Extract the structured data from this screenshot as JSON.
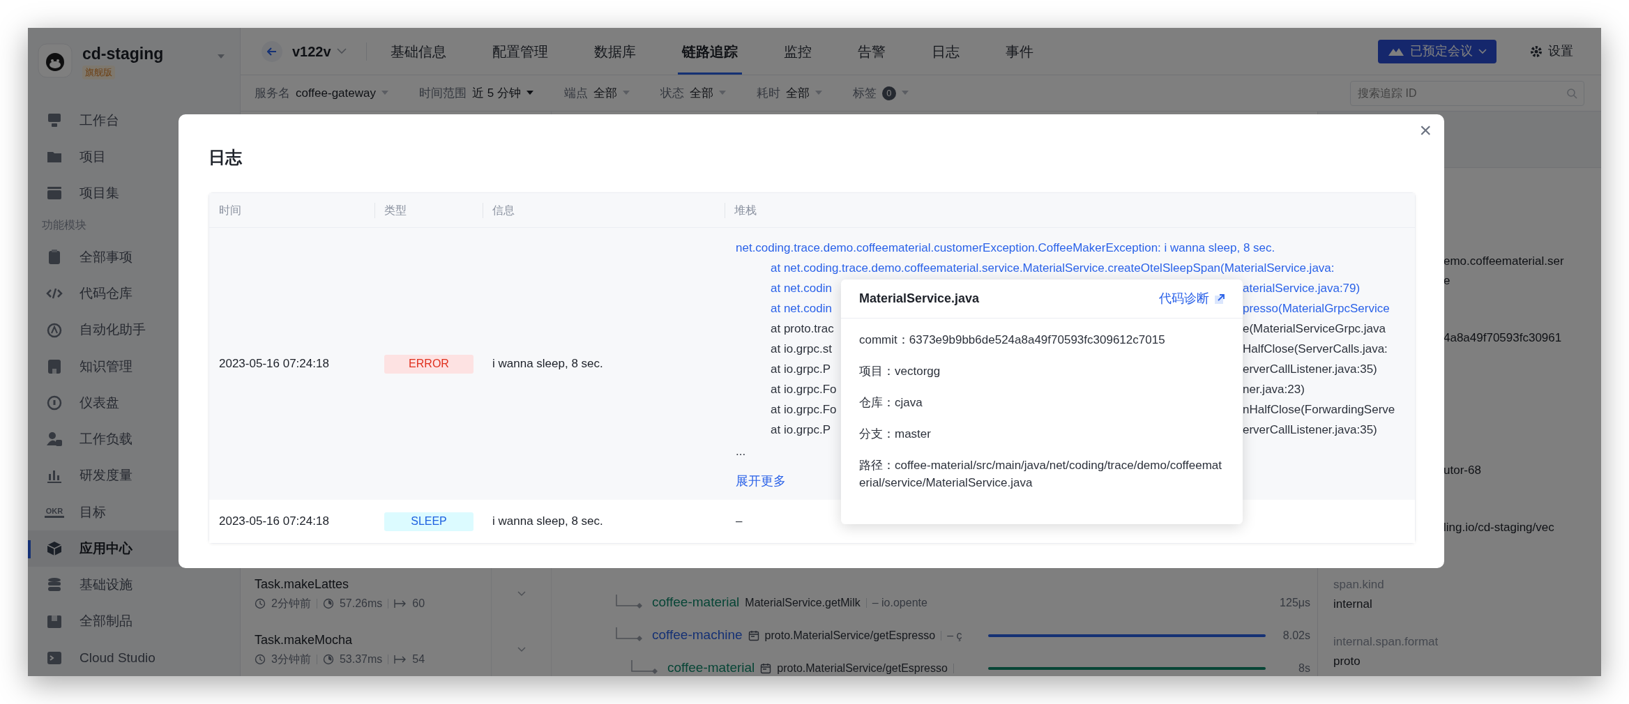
{
  "sidebar": {
    "org": "cd-staging",
    "edition": "旗舰版",
    "items": [
      {
        "kind": "item",
        "label": "工作台",
        "selected": false
      },
      {
        "kind": "item",
        "label": "项目",
        "selected": false
      },
      {
        "kind": "item",
        "label": "项目集",
        "selected": false
      },
      {
        "kind": "section",
        "label": "功能模块"
      },
      {
        "kind": "item",
        "label": "全部事项",
        "selected": false
      },
      {
        "kind": "item",
        "label": "代码仓库",
        "selected": false
      },
      {
        "kind": "item",
        "label": "自动化助手",
        "selected": false
      },
      {
        "kind": "item",
        "label": "知识管理",
        "selected": false
      },
      {
        "kind": "item",
        "label": "仪表盘",
        "selected": false
      },
      {
        "kind": "item",
        "label": "工作负载",
        "selected": false
      },
      {
        "kind": "item",
        "label": "研发度量",
        "selected": false
      },
      {
        "kind": "item",
        "label": "目标",
        "selected": false,
        "icon_label": "OKR"
      },
      {
        "kind": "item",
        "label": "应用中心",
        "selected": true
      },
      {
        "kind": "item",
        "label": "基础设施",
        "selected": false
      },
      {
        "kind": "item",
        "label": "全部制品",
        "selected": false
      },
      {
        "kind": "item",
        "label": "Cloud Studio",
        "selected": false
      }
    ]
  },
  "topbar": {
    "version": "v122v",
    "tabs": [
      {
        "label": "基础信息",
        "selected": false
      },
      {
        "label": "配置管理",
        "selected": false
      },
      {
        "label": "数据库",
        "selected": false
      },
      {
        "label": "链路追踪",
        "selected": true
      },
      {
        "label": "监控",
        "selected": false
      },
      {
        "label": "告警",
        "selected": false
      },
      {
        "label": "日志",
        "selected": false
      },
      {
        "label": "事件",
        "selected": false
      }
    ],
    "meeting_button": "已预定会议",
    "settings": "设置"
  },
  "filters": {
    "items": [
      {
        "kind": "select",
        "label": "服务名",
        "value": "coffee-gateway",
        "emphasized": false
      },
      {
        "kind": "select",
        "label": "时间范围",
        "value": "近 5 分钟",
        "emphasized": true
      },
      {
        "kind": "select",
        "label": "端点",
        "value": "全部",
        "emphasized": false
      },
      {
        "kind": "select",
        "label": "状态",
        "value": "全部",
        "emphasized": false
      },
      {
        "kind": "select",
        "label": "耗时",
        "value": "全部",
        "emphasized": false
      },
      {
        "kind": "count",
        "label": "标签",
        "value": "0",
        "emphasized": false
      }
    ],
    "search": {
      "placeholder": "搜索追踪 ID"
    }
  },
  "trace_list": [
    {
      "name": "Task.makeLattes",
      "age": "2分钟前",
      "duration": "57.26ms",
      "spans": "60"
    },
    {
      "name": "Task.makeMocha",
      "age": "3分钟前",
      "duration": "53.37ms",
      "spans": "54"
    }
  ],
  "spans": [
    {
      "service": "coffee-material",
      "kind": "material",
      "operation": "MaterialService.getMilk",
      "detail": "– io.opente",
      "duration": "125μs",
      "bar": false
    },
    {
      "service": "coffee-machine",
      "kind": "machine",
      "operation": "proto.MaterialService/getEspresso",
      "detail": "– ç",
      "duration": "8.02s",
      "bar": true,
      "children": [
        {
          "service": "coffee-material",
          "kind": "material",
          "operation": "proto.MaterialService/getEspresso",
          "duration": "8s",
          "bar": true
        }
      ]
    }
  ],
  "attributes_panel": {
    "cut_values": [
      "emo.coffeematerial.ser",
      "e",
      "4a8a49f70593fc30961",
      "utor-68",
      "ling.io/cd-staging/vec"
    ],
    "attributes": [
      {
        "key": "span.kind",
        "value": "internal"
      },
      {
        "key": "internal.span.format",
        "value": "proto"
      }
    ]
  },
  "modal": {
    "title": "日志",
    "close": "×",
    "columns": [
      "时间",
      "类型",
      "信息",
      "堆栈"
    ],
    "rows": [
      {
        "time": "2023-05-16 07:24:18",
        "type": "ERROR",
        "kind": "error",
        "message": "i wanna sleep, 8 sec.",
        "stack": {
          "exception": "net.coding.trace.demo.coffeematerial.customerException.CoffeeMakerException: i wanna sleep, 8 sec.",
          "children": [
            {
              "left": "at net.coding.trace.demo.coffeematerial.service.MaterialService.createOtelSleepSpan(MaterialService.java:",
              "link": true
            },
            {
              "left": "at net.codin",
              "right": "aterialService.java:79)",
              "link": true
            },
            {
              "left": "at net.codin",
              "right": "presso(MaterialGrpcService",
              "link": true
            },
            {
              "left": "at proto.trac",
              "right": "e(MaterialServiceGrpc.java",
              "link": false
            },
            {
              "left": "at io.grpc.st",
              "right": "HalfClose(ServerCalls.java:",
              "link": false
            },
            {
              "left": "at io.grpc.P",
              "right": "erverCallListener.java:35)",
              "link": false
            },
            {
              "left": "at io.grpc.Fo",
              "right": "ner.java:23)",
              "link": false
            },
            {
              "left": "at io.grpc.Fo",
              "right": "nHalfClose(ForwardingServe",
              "link": false
            },
            {
              "left": "at io.grpc.P",
              "right": "erverCallListener.java:35)",
              "link": false
            }
          ],
          "ellipsis": "...",
          "expand": "展开更多"
        }
      },
      {
        "time": "2023-05-16 07:24:18",
        "type": "SLEEP",
        "kind": "sleep",
        "message": "i wanna sleep, 8 sec.",
        "stack_text": "–"
      }
    ],
    "popover": {
      "title": "MaterialService.java",
      "link": "代码诊断",
      "fields": [
        "commit：6373e9b9bb6de524a8a49f70593fc309612c7015",
        "项目：vectorgg",
        "仓库：cjava",
        "分支：master",
        "路径：coffee-material/src/main/java/net/coding/trace/demo/coffeematerial/service/MaterialService.java"
      ]
    }
  }
}
